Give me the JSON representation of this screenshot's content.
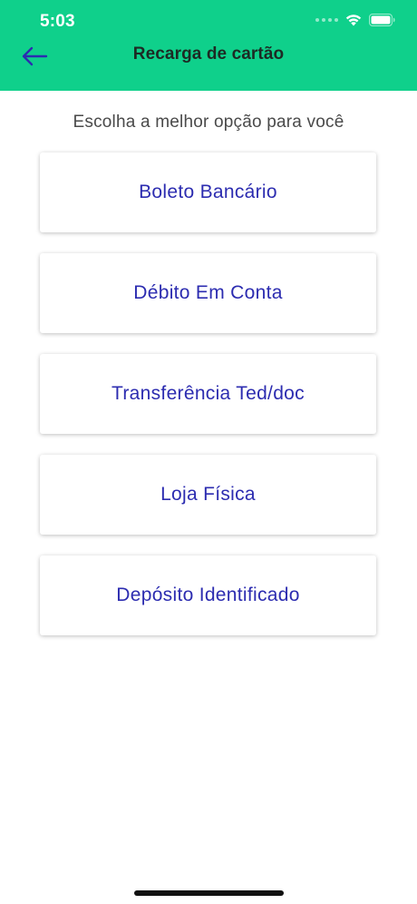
{
  "status_bar": {
    "time": "5:03"
  },
  "header": {
    "title": "Recarga de cartão",
    "back_icon": "arrow-left-icon",
    "background_color": "#0fd08b",
    "back_icon_color": "#2c2cb0"
  },
  "main": {
    "subtitle": "Escolha a melhor opção para você",
    "options": [
      {
        "label": "Boleto Bancário"
      },
      {
        "label": "Débito Em Conta"
      },
      {
        "label": "Transferência Ted/doc"
      },
      {
        "label": "Loja Física"
      },
      {
        "label": "Depósito Identificado"
      }
    ],
    "option_text_color": "#2c2cb0"
  }
}
